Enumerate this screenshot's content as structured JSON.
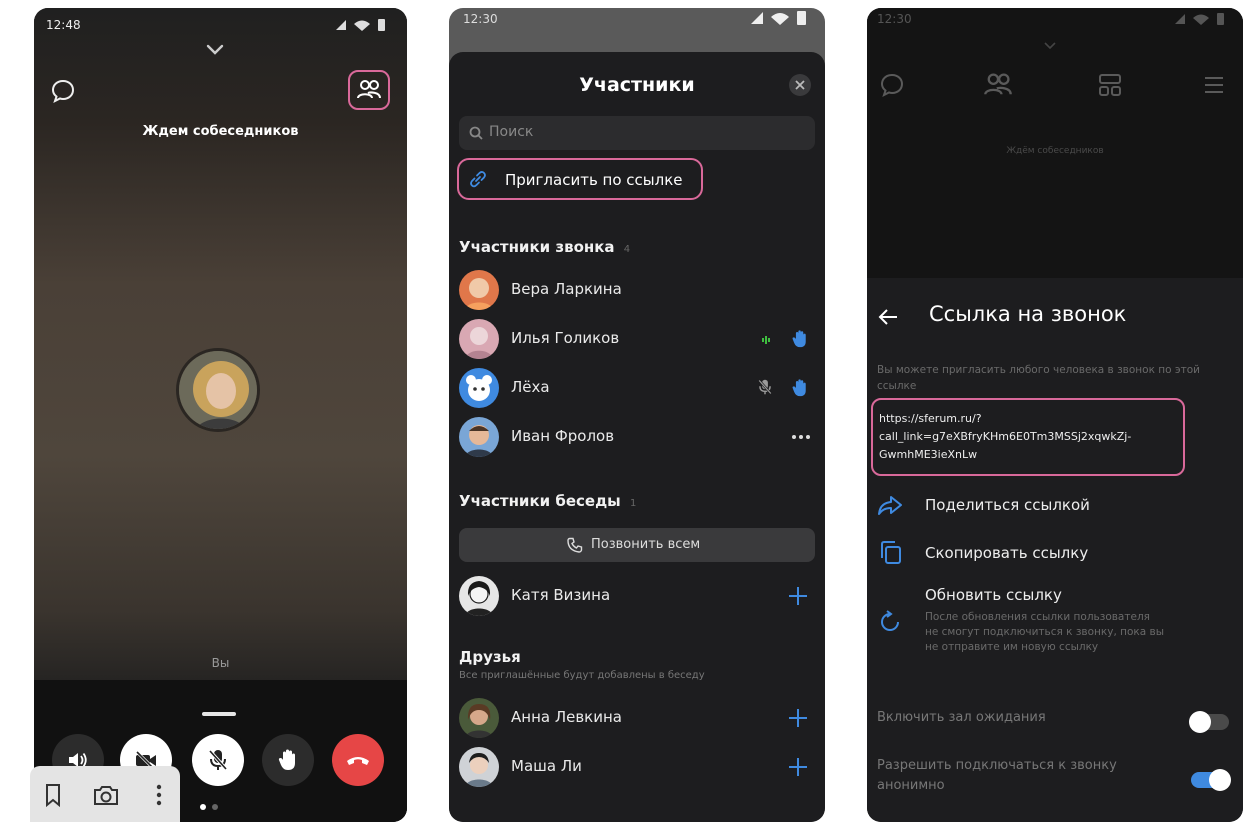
{
  "left_phone": {
    "time": "12:48",
    "status_text": "Ждем собеседников",
    "self_label": "Вы"
  },
  "middle_phone": {
    "time": "12:30",
    "title": "Участники",
    "search_placeholder": "Поиск",
    "invite_label": "Пригласить по ссылке",
    "call_section": {
      "title": "Участники звонка",
      "count": "4"
    },
    "call_members": [
      {
        "name": "Вера Ларкина"
      },
      {
        "name": "Илья Голиков"
      },
      {
        "name": "Лёха"
      },
      {
        "name": "Иван Фролов"
      }
    ],
    "chat_section": {
      "title": "Участники беседы",
      "count": "1"
    },
    "call_all_label": "Позвонить всем",
    "chat_members": [
      {
        "name": "Катя Визина"
      }
    ],
    "friends_section": {
      "title": "Друзья",
      "subtitle": "Все приглашённые будут добавлены в беседу"
    },
    "friends": [
      {
        "name": "Анна Левкина"
      },
      {
        "name": "Маша Ли"
      }
    ]
  },
  "right_phone": {
    "time": "12:30",
    "faded_status": "Ждём собеседников",
    "title": "Ссылка на звонок",
    "description": "Вы можете пригласить любого человека в звонок по этой ссылке",
    "link_lines": [
      "https://sferum.ru/?",
      "call_link=g7eXBfryKHm6E0Tm3MSSj2xqwkZj-",
      "GwmhME3ieXnLw"
    ],
    "share_label": "Поделиться ссылкой",
    "copy_label": "Скопировать ссылку",
    "refresh_label": "Обновить ссылку",
    "refresh_note_lines": [
      "После обновления ссылки пользователя",
      "не смогут подключиться к звонку, пока вы",
      "не отправите им новую ссылку"
    ],
    "waiting_room_label": "Включить зал ожидания",
    "waiting_room_on": false,
    "anon_label_lines": [
      "Разрешить подключаться к звонку",
      "анонимно"
    ],
    "anon_on": true
  },
  "colors": {
    "highlight": "#d9699a",
    "end_call": "#e64646",
    "blue": "#3f8ae0",
    "green": "#3fbf3f"
  }
}
